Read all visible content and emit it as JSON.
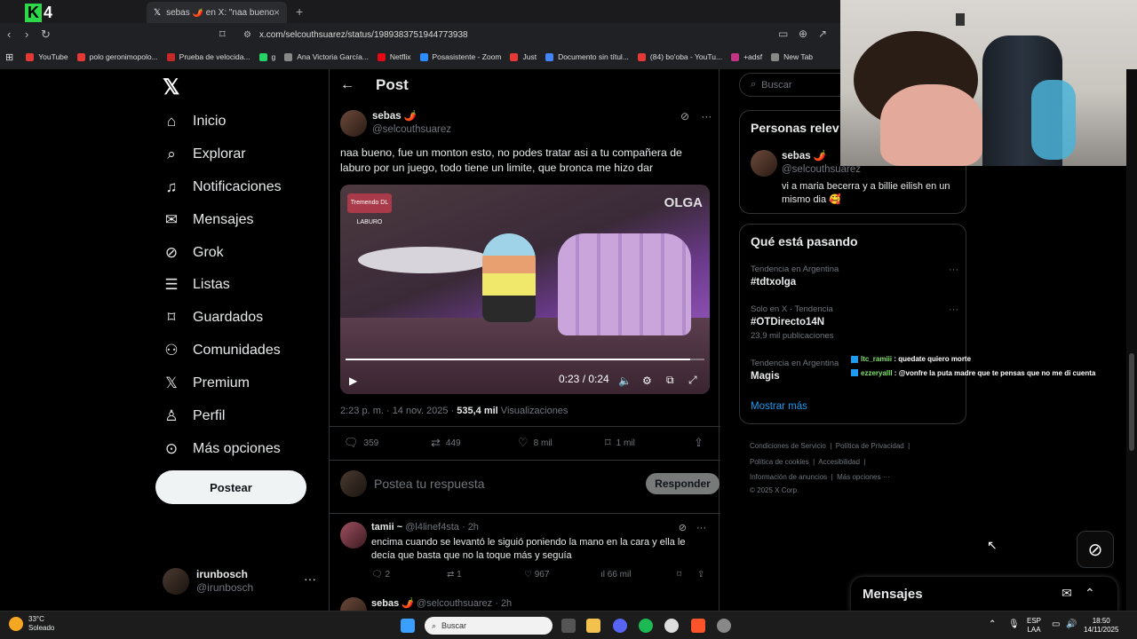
{
  "browser": {
    "active_tab_title": "sebas 🌶️ en X: \"naa bueno, fue",
    "first_tab_prefix": "[",
    "kick_logo": "K4",
    "url": "x.com/selcouthsuarez/status/1989383751944773938",
    "bookmarks": [
      "YouTube",
      "polo geronimopolo...",
      "Prueba de velocida...",
      "g",
      "Ana Victoria García...",
      "Netflix",
      "Posasistente - Zoom",
      "Just",
      "Documento sin títul...",
      "(84) bo'oba - YouTu...",
      "+adsf",
      "New Tab"
    ],
    "bookmark_colors": [
      "#e53935",
      "#e53935",
      "#c62828",
      "#25d366",
      "#888888",
      "#e50914",
      "#2d8cff",
      "#e53935",
      "#4285f4",
      "#e53935",
      "#c13584",
      "#888888"
    ]
  },
  "nav": {
    "items": [
      {
        "label": "Inicio",
        "icon": "home-icon",
        "glyph": "⌂"
      },
      {
        "label": "Explorar",
        "icon": "search-icon",
        "glyph": "⌕"
      },
      {
        "label": "Notificaciones",
        "icon": "bell-icon",
        "glyph": "♫"
      },
      {
        "label": "Mensajes",
        "icon": "mail-icon",
        "glyph": "✉"
      },
      {
        "label": "Grok",
        "icon": "grok-icon",
        "glyph": "⊘"
      },
      {
        "label": "Listas",
        "icon": "list-icon",
        "glyph": "☰"
      },
      {
        "label": "Guardados",
        "icon": "bookmark-icon",
        "glyph": "⌑"
      },
      {
        "label": "Comunidades",
        "icon": "communities-icon",
        "glyph": "⚇"
      },
      {
        "label": "Premium",
        "icon": "x-premium-icon",
        "glyph": "𝕏"
      },
      {
        "label": "Perfil",
        "icon": "profile-icon",
        "glyph": "♙"
      },
      {
        "label": "Más opciones",
        "icon": "more-options-icon",
        "glyph": "⊙"
      }
    ],
    "post_button": "Postear",
    "account_name": "irunbosch",
    "account_handle": "@irunbosch"
  },
  "post": {
    "header": "Post",
    "author_name": "sebas 🌶️",
    "author_handle": "@selcouthsuarez",
    "text": "naa bueno, fue un monton esto, no podes tratar asi a tu compañera de laburo por un juego, todo tiene un limite, que bronca me hizo dar",
    "video": {
      "watermark": "OLGA",
      "show_logo": "Tremendo DL LABURO",
      "time": "0:23 / 0:24",
      "progress": 0.96
    },
    "time": "2:23 p. m. · 14 nov. 2025 · ",
    "views": "535,4 mil",
    "views_label": " Visualizaciones",
    "stats": {
      "replies": "359",
      "reposts": "449",
      "likes": "8 mil",
      "bookmarks": "1 mil"
    },
    "reply_placeholder": "Postea tu respuesta",
    "reply_button": "Responder"
  },
  "replies": [
    {
      "name": "tamii ~",
      "handle": "@l4linef4sta · 2h",
      "text": "encima cuando se levantó le siguió poniendo la mano en la cara y ella le decía que basta que no la toque más y seguía",
      "replies": "2",
      "reposts": "1",
      "likes": "967",
      "views": "66 mil"
    },
    {
      "name": "sebas 🌶️",
      "handle": "@selcouthsuarez · 2h"
    }
  ],
  "sidebar": {
    "search_placeholder": "Buscar",
    "relevant_title": "Personas relev",
    "relevant_name": "sebas 🌶️",
    "relevant_handle": "@selcouthsuarez",
    "relevant_bio": "vi a maria becerra y a billie eilish en un mismo dia 🥰",
    "trending_title": "Qué está pasando",
    "trends": [
      {
        "context": "Tendencia en Argentina",
        "name": "#tdtxolga",
        "count": ""
      },
      {
        "context": "Solo en X · Tendencia",
        "name": "#OTDirecto14N",
        "count": "23,9 mil publicaciones"
      },
      {
        "context": "Tendencia en Argentina",
        "name": "Magis",
        "count": ""
      }
    ],
    "show_more": "Mostrar más",
    "footer": [
      "Condiciones de Servicio",
      "Política de Privacidad",
      "Política de cookies",
      "Accesibilidad",
      "Información de anuncios",
      "Más opciones ···",
      "© 2025 X Corp."
    ]
  },
  "chat": [
    {
      "user": "ltc_ramiii",
      "msg": " : quedate quiero morte"
    },
    {
      "user": "ezzeryalll",
      "msg": " : @vonfre la puta madre que te pensas que no me di cuenta"
    }
  ],
  "messages_drawer": "Mensajes",
  "taskbar": {
    "temp": "33°C",
    "weather": "Soleado",
    "search": "Buscar",
    "lang": "ESP",
    "lang2": "LAA",
    "time": "18:50",
    "date": "14/11/2025"
  }
}
